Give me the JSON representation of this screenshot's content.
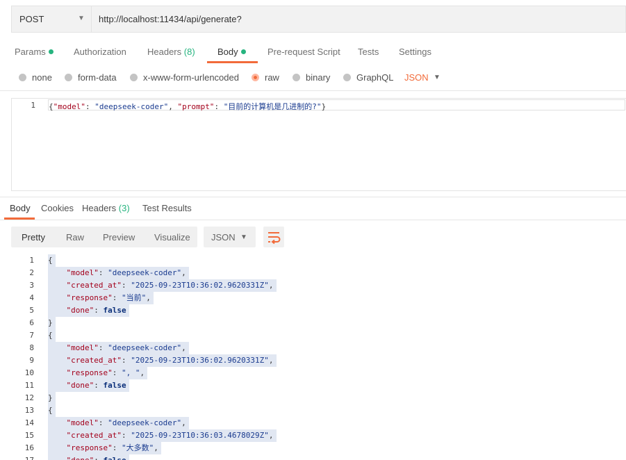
{
  "request": {
    "method": "POST",
    "url": "http://localhost:11434/api/generate?"
  },
  "request_tabs": {
    "params": "Params",
    "authorization": "Authorization",
    "headers": "Headers",
    "headers_count": "(8)",
    "body": "Body",
    "pre_request": "Pre-request Script",
    "tests": "Tests",
    "settings": "Settings"
  },
  "body_types": {
    "none": "none",
    "form_data": "form-data",
    "urlencoded": "x-www-form-urlencoded",
    "raw": "raw",
    "binary": "binary",
    "graphql": "GraphQL",
    "format": "JSON"
  },
  "request_body": {
    "line_number": "1",
    "open": "{",
    "k1": "\"model\"",
    "sep1": ": ",
    "v1": "\"deepseek-coder\"",
    "comma1": ", ",
    "k2": "\"prompt\"",
    "sep2": ": ",
    "v2": "\"目前的计算机是几进制的?\"",
    "close": "}"
  },
  "response_tabs": {
    "body": "Body",
    "cookies": "Cookies",
    "headers": "Headers",
    "headers_count": "(3)",
    "test_results": "Test Results"
  },
  "response_toolbar": {
    "pretty": "Pretty",
    "raw": "Raw",
    "preview": "Preview",
    "visualize": "Visualize",
    "format": "JSON"
  },
  "response_lines": [
    {
      "n": "1",
      "open": "{"
    },
    {
      "n": "2",
      "key": "\"model\"",
      "val": "\"deepseek-coder\"",
      "tail": ","
    },
    {
      "n": "3",
      "key": "\"created_at\"",
      "val": "\"2025-09-23T10:36:02.9620331Z\"",
      "tail": ","
    },
    {
      "n": "4",
      "key": "\"response\"",
      "val": "\"当前\"",
      "tail": ","
    },
    {
      "n": "5",
      "key": "\"done\"",
      "kw": "false"
    },
    {
      "n": "6",
      "close": "}"
    },
    {
      "n": "7",
      "open": "{"
    },
    {
      "n": "8",
      "key": "\"model\"",
      "val": "\"deepseek-coder\"",
      "tail": ","
    },
    {
      "n": "9",
      "key": "\"created_at\"",
      "val": "\"2025-09-23T10:36:02.9620331Z\"",
      "tail": ","
    },
    {
      "n": "10",
      "key": "\"response\"",
      "val": "\", \"",
      "tail": ","
    },
    {
      "n": "11",
      "key": "\"done\"",
      "kw": "false"
    },
    {
      "n": "12",
      "close": "}"
    },
    {
      "n": "13",
      "open": "{"
    },
    {
      "n": "14",
      "key": "\"model\"",
      "val": "\"deepseek-coder\"",
      "tail": ","
    },
    {
      "n": "15",
      "key": "\"created_at\"",
      "val": "\"2025-09-23T10:36:03.4678029Z\"",
      "tail": ","
    },
    {
      "n": "16",
      "key": "\"response\"",
      "val": "\"大多数\"",
      "tail": ","
    },
    {
      "n": "17",
      "key": "\"done\"",
      "kw": "false"
    }
  ],
  "colors": {
    "accent": "#f26b3a",
    "success": "#26b47f",
    "highlight": "#e1e7f2"
  }
}
